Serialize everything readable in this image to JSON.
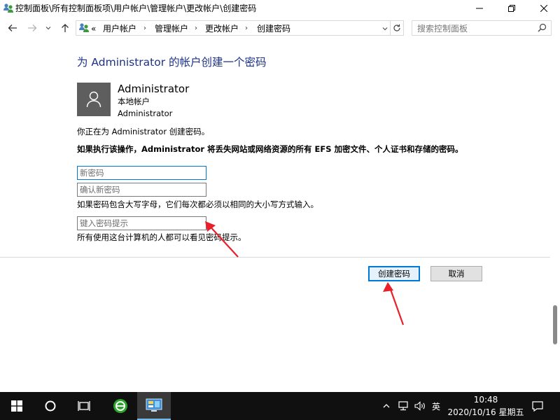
{
  "window": {
    "title": "控制面板\\所有控制面板项\\用户帐户\\管理帐户\\更改帐户\\创建密码"
  },
  "nav": {
    "back_icon": "back-arrow-icon",
    "forward_icon": "forward-arrow-icon",
    "recent_icon": "chevron-down-icon",
    "up_icon": "up-arrow-icon"
  },
  "address": {
    "overflow": "«",
    "crumbs": [
      "用户帐户",
      "管理帐户",
      "更改帐户",
      "创建密码"
    ]
  },
  "search": {
    "placeholder": "搜索控制面板"
  },
  "page": {
    "heading": "为 Administrator 的帐户创建一个密码",
    "user": {
      "name": "Administrator",
      "type": "本地帐户",
      "group": "Administrator"
    },
    "intro": "你正在为 Administrator 创建密码。",
    "warning": "如果执行该操作，Administrator 将丢失网站或网络资源的所有 EFS 加密文件、个人证书和存储的密码。",
    "new_password_placeholder": "新密码",
    "confirm_password_placeholder": "确认新密码",
    "case_note": "如果密码包含大写字母，它们每次都必须以相同的大小写方式输入。",
    "hint_placeholder": "键入密码提示",
    "hint_note": "所有使用这台计算机的人都可以看见密码提示。",
    "create_button": "创建密码",
    "cancel_button": "取消"
  },
  "taskbar": {
    "ime": "英",
    "time": "10:48",
    "date": "2020/10/16 星期五",
    "accent": "#76b9ed"
  },
  "colors": {
    "heading": "#1e3287",
    "focus": "#0078d7",
    "annotation": "#e8202a"
  }
}
